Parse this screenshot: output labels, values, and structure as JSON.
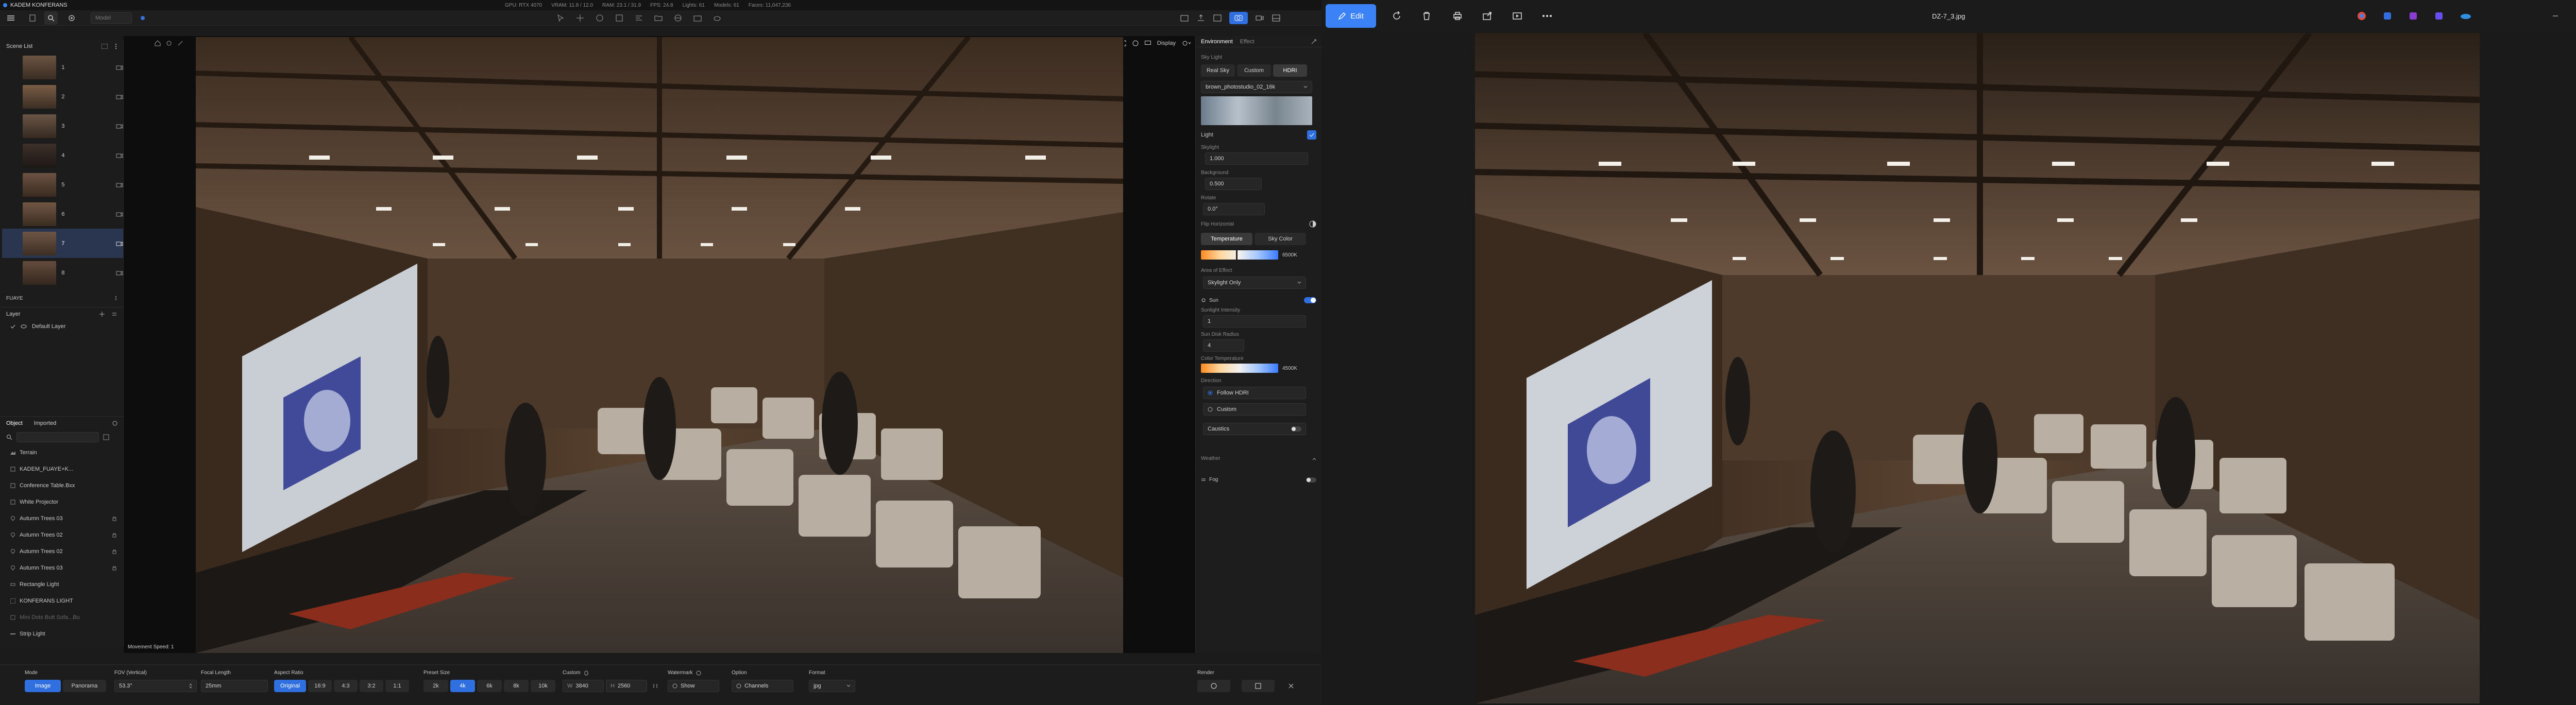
{
  "app": {
    "title": "KADEM KONFERANS",
    "menu_icons": [
      "menu-icon",
      "file-icon",
      "search-icon",
      "settings-icon"
    ],
    "search_placeholder": "Model",
    "stats": [
      "GPU: RTX 4070",
      "VRAM: 11.8 / 12.0",
      "RAM: 23.1 / 31.9",
      "FPS: 24.8",
      "Lights: 61",
      "Models: 61",
      "Faces: 11,047,236"
    ]
  },
  "scene_list": {
    "title": "Scene List",
    "items": [
      {
        "label": "1"
      },
      {
        "label": "2"
      },
      {
        "label": "3"
      },
      {
        "label": "4"
      },
      {
        "label": "5"
      },
      {
        "label": "6"
      },
      {
        "label": "7",
        "selected": true
      },
      {
        "label": "8"
      }
    ]
  },
  "folder": {
    "label": "FUAYE"
  },
  "layer_panel": {
    "title": "Layer",
    "default_layer": "Default Layer"
  },
  "object_panel": {
    "tab_object": "Object",
    "tab_imported": "Imported",
    "items": [
      "Terrain",
      "KADEM_FUAYE+K...",
      "Conference Table.Bxx",
      "White Projector",
      "Autumn Trees 03",
      "Autumn Trees 02",
      "Autumn Trees 02",
      "Autumn Trees 03",
      "Rectangle Light",
      "KONFERANS LIGHT",
      "Mini Dots Butt Sofa...Bu",
      "Strip Light"
    ]
  },
  "viewport": {
    "display_label": "Display",
    "movement_speed": "Movement Speed: 1"
  },
  "bottom_bar": {
    "mode_label": "Mode",
    "mode_image": "Image",
    "mode_panorama": "Panorama",
    "fov_label": "FOV (Vertical)",
    "fov_value": "53.3°",
    "focal_label": "Focal Length",
    "focal_value": "25mm",
    "aspect_label": "Aspect Ratio",
    "aspect_options": [
      "Original",
      "16:9",
      "4:3",
      "3:2",
      "1:1"
    ],
    "preset_label": "Preset Size",
    "preset_options": [
      "2k",
      "4k",
      "6k",
      "8k",
      "10k"
    ],
    "custom_label": "Custom",
    "custom_w_label": "W",
    "custom_w": "3840",
    "custom_h_label": "H",
    "custom_h": "2560",
    "watermark_label": "Watermark",
    "watermark_show": "Show",
    "option_label": "Option",
    "option_channels": "Channels",
    "format_label": "Format",
    "format_value": "jpg",
    "render_label": "Render"
  },
  "env_panel": {
    "tab_environment": "Environment",
    "tab_effect": "Effect",
    "sky_light_title": "Sky Light",
    "sky_tabs": [
      "Real Sky",
      "Custom",
      "HDRI"
    ],
    "hdri_name": "brown_photostudio_02_16k",
    "light_label": "Light",
    "skylight_label": "Skylight",
    "skylight_value": "1.000",
    "background_label": "Background",
    "background_value": "0.500",
    "rotate_label": "Rotate",
    "rotate_value": "0.0°",
    "flip_label": "Flip Horizontal",
    "temp_tab": "Temperature",
    "sky_color_tab": "Sky Color",
    "temp_value": "6500K",
    "area_label": "Area of Effect",
    "area_value": "Skylight Only",
    "sun_label": "Sun",
    "sun_intensity_label": "Sunlight Intensity",
    "sun_intensity_value": "1",
    "sun_disk_label": "Sun Disk Radius",
    "sun_disk_value": "4",
    "color_temp_label": "Color Temperature",
    "color_temp_value": "4500K",
    "direction_label": "Direction",
    "follow_hdri": "Follow HDRI",
    "custom": "Custom",
    "caustics_label": "Caustics",
    "weather_label": "Weather",
    "fog_label": "Fog"
  },
  "viewer": {
    "edit_label": "Edit",
    "filename": "DZ-7_3.jpg"
  },
  "colors": {
    "accent": "#2f6fe0",
    "viewer_edit": "#3b82f6"
  }
}
